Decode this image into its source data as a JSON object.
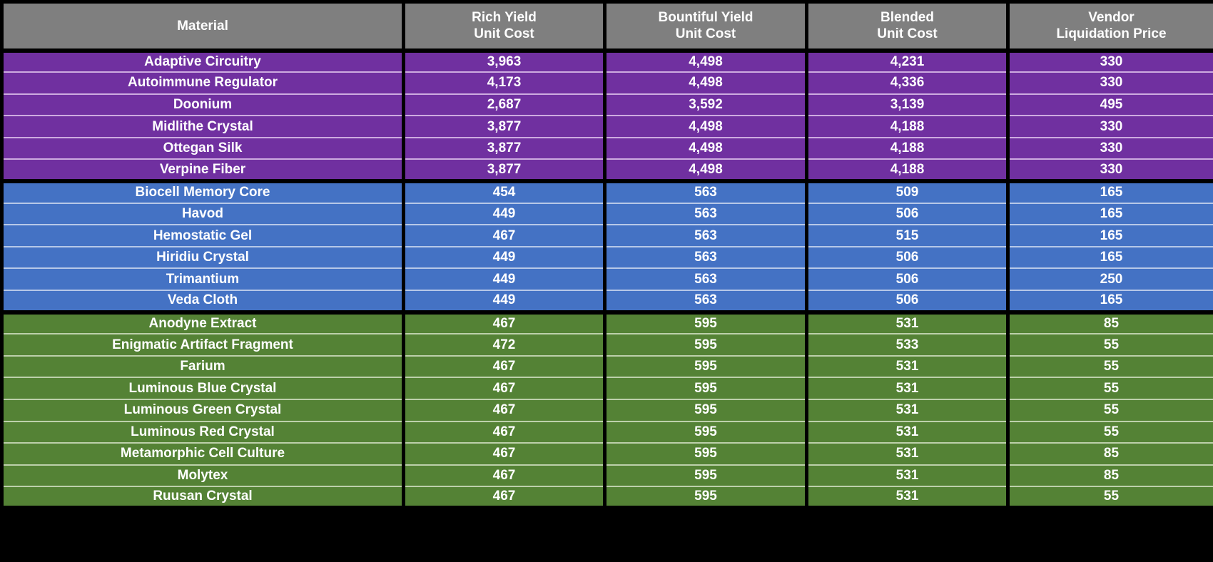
{
  "table": {
    "columns": [
      {
        "key": "material",
        "lines": [
          "Material"
        ]
      },
      {
        "key": "rich",
        "lines": [
          "Rich Yield",
          "Unit Cost"
        ]
      },
      {
        "key": "bountiful",
        "lines": [
          "Bountiful Yield",
          "Unit Cost"
        ]
      },
      {
        "key": "blended",
        "lines": [
          "Blended",
          "Unit Cost"
        ]
      },
      {
        "key": "vendor",
        "lines": [
          "Vendor",
          "Liquidation Price"
        ]
      }
    ],
    "header": {
      "col1_line1": "Material",
      "col2_line1": "Rich Yield",
      "col2_line2": "Unit Cost",
      "col3_line1": "Bountiful Yield",
      "col3_line2": "Unit Cost",
      "col4_line1": "Blended",
      "col4_line2": "Unit Cost",
      "col5_line1": "Vendor",
      "col5_line2": "Liquidation Price"
    },
    "colors": {
      "header_bg": "#7f7f7f",
      "grid": "#000000",
      "text": "#ffffff",
      "group_purple_bg": "#7030a0",
      "group_purple_rule": "#cdabe0",
      "group_blue_bg": "#4472c4",
      "group_blue_rule": "#b7c8e8",
      "group_green_bg": "#548235",
      "group_green_rule": "#bdd0ab"
    },
    "groups": [
      {
        "name": "purple-tier",
        "color": "#7030a0",
        "rows": [
          {
            "material": "Adaptive Circuitry",
            "rich": "3,963",
            "bountiful": "4,498",
            "blended": "4,231",
            "vendor": "330"
          },
          {
            "material": "Autoimmune Regulator",
            "rich": "4,173",
            "bountiful": "4,498",
            "blended": "4,336",
            "vendor": "330"
          },
          {
            "material": "Doonium",
            "rich": "2,687",
            "bountiful": "3,592",
            "blended": "3,139",
            "vendor": "495"
          },
          {
            "material": "Midlithe Crystal",
            "rich": "3,877",
            "bountiful": "4,498",
            "blended": "4,188",
            "vendor": "330"
          },
          {
            "material": "Ottegan Silk",
            "rich": "3,877",
            "bountiful": "4,498",
            "blended": "4,188",
            "vendor": "330"
          },
          {
            "material": "Verpine Fiber",
            "rich": "3,877",
            "bountiful": "4,498",
            "blended": "4,188",
            "vendor": "330"
          }
        ]
      },
      {
        "name": "blue-tier",
        "color": "#4472c4",
        "rows": [
          {
            "material": "Biocell Memory Core",
            "rich": "454",
            "bountiful": "563",
            "blended": "509",
            "vendor": "165"
          },
          {
            "material": "Havod",
            "rich": "449",
            "bountiful": "563",
            "blended": "506",
            "vendor": "165"
          },
          {
            "material": "Hemostatic Gel",
            "rich": "467",
            "bountiful": "563",
            "blended": "515",
            "vendor": "165"
          },
          {
            "material": "Hiridiu Crystal",
            "rich": "449",
            "bountiful": "563",
            "blended": "506",
            "vendor": "165"
          },
          {
            "material": "Trimantium",
            "rich": "449",
            "bountiful": "563",
            "blended": "506",
            "vendor": "250"
          },
          {
            "material": "Veda Cloth",
            "rich": "449",
            "bountiful": "563",
            "blended": "506",
            "vendor": "165"
          }
        ]
      },
      {
        "name": "green-tier",
        "color": "#548235",
        "rows": [
          {
            "material": "Anodyne Extract",
            "rich": "467",
            "bountiful": "595",
            "blended": "531",
            "vendor": "85"
          },
          {
            "material": "Enigmatic Artifact Fragment",
            "rich": "472",
            "bountiful": "595",
            "blended": "533",
            "vendor": "55"
          },
          {
            "material": "Farium",
            "rich": "467",
            "bountiful": "595",
            "blended": "531",
            "vendor": "55"
          },
          {
            "material": "Luminous Blue Crystal",
            "rich": "467",
            "bountiful": "595",
            "blended": "531",
            "vendor": "55"
          },
          {
            "material": "Luminous Green Crystal",
            "rich": "467",
            "bountiful": "595",
            "blended": "531",
            "vendor": "55"
          },
          {
            "material": "Luminous Red Crystal",
            "rich": "467",
            "bountiful": "595",
            "blended": "531",
            "vendor": "55"
          },
          {
            "material": "Metamorphic Cell Culture",
            "rich": "467",
            "bountiful": "595",
            "blended": "531",
            "vendor": "85"
          },
          {
            "material": "Molytex",
            "rich": "467",
            "bountiful": "595",
            "blended": "531",
            "vendor": "85"
          },
          {
            "material": "Ruusan Crystal",
            "rich": "467",
            "bountiful": "595",
            "blended": "531",
            "vendor": "55"
          }
        ]
      }
    ]
  }
}
